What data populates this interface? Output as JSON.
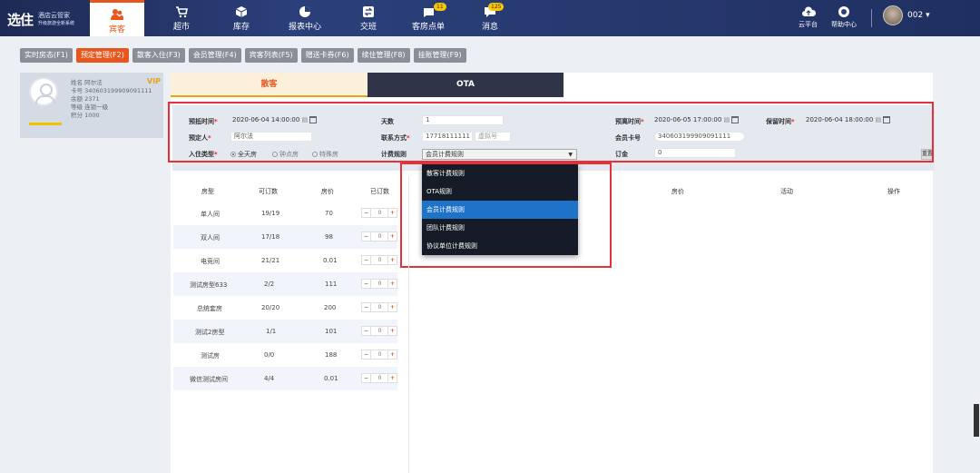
{
  "app": {
    "logo": "选住",
    "sub1": "酒店云管家",
    "sub2": "升级旅游全新系统"
  },
  "nav": [
    {
      "label": "宾客",
      "icon": "guests-icon",
      "active": true
    },
    {
      "label": "超市",
      "icon": "cart-icon"
    },
    {
      "label": "库存",
      "icon": "box-icon"
    },
    {
      "label": "报表中心",
      "icon": "chart-icon"
    },
    {
      "label": "交班",
      "icon": "shift-icon"
    },
    {
      "label": "客房点单",
      "icon": "order-icon",
      "badge": "11"
    },
    {
      "label": "消息",
      "icon": "message-icon",
      "badge": "125"
    }
  ],
  "topright": {
    "cloud": "云平台",
    "help": "帮助中心",
    "user": "002"
  },
  "tabs": [
    "实时房态(F1)",
    "预定管理(F2)",
    "散客入住(F3)",
    "会员管理(F4)",
    "宾客列表(F5)",
    "赠送卡券(F6)",
    "续住管理(F8)",
    "挂账管理(F9)"
  ],
  "profile": {
    "vip": "VIP",
    "name": "姓名 阿尔法",
    "card": "卡号 340603199909091111",
    "balance": "余额 2371",
    "level": "等级 连锁一级",
    "points": "积分 1000"
  },
  "mtabs": {
    "t1": "散客",
    "t2": "OTA"
  },
  "form": {
    "book_time_label": "预抵时间",
    "book_time": "2020-06-04 14:00:00",
    "days_label": "天数",
    "days": "1",
    "leave_time_label": "预离时间",
    "leave_time": "2020-06-05 17:00:00",
    "keep_time_label": "保留时间",
    "keep_time": "2020-06-04 18:00:00",
    "booker_label": "预定人",
    "booker": "阿尔法",
    "contact_label": "联系方式",
    "contact": "17718111111",
    "virtual": "虚拟号",
    "member_card_label": "会员卡号",
    "member_card": "340603199909091111",
    "stay_type_label": "入住类型",
    "stay_types": [
      "全天房",
      "钟点房",
      "特殊房"
    ],
    "rule_label": "计费规则",
    "rule_selected": "会员计费规则",
    "deposit_label": "订金",
    "deposit": "0",
    "reset": "重置"
  },
  "dropdown": [
    "散客计费规则",
    "OTA规则",
    "会员计费规则",
    "团队计费规则",
    "协议单位计费规则"
  ],
  "table": {
    "headers": [
      "房型",
      "可订数",
      "房价",
      "已订数"
    ],
    "rows": [
      [
        "单人间",
        "19/19",
        "70",
        "0"
      ],
      [
        "双人间",
        "17/18",
        "98",
        "0"
      ],
      [
        "电竞间",
        "21/21",
        "0.01",
        "0"
      ],
      [
        "测试房型633",
        "2/2",
        "111",
        "0"
      ],
      [
        "总统套房",
        "20/20",
        "200",
        "0"
      ],
      [
        "测试2房型",
        "1/1",
        "101",
        "0"
      ],
      [
        "测试房",
        "0/0",
        "188",
        "0"
      ],
      [
        "微信测试房间",
        "4/4",
        "0.01",
        "0"
      ]
    ]
  },
  "right_headers": [
    "房价",
    "活动",
    "操作"
  ]
}
